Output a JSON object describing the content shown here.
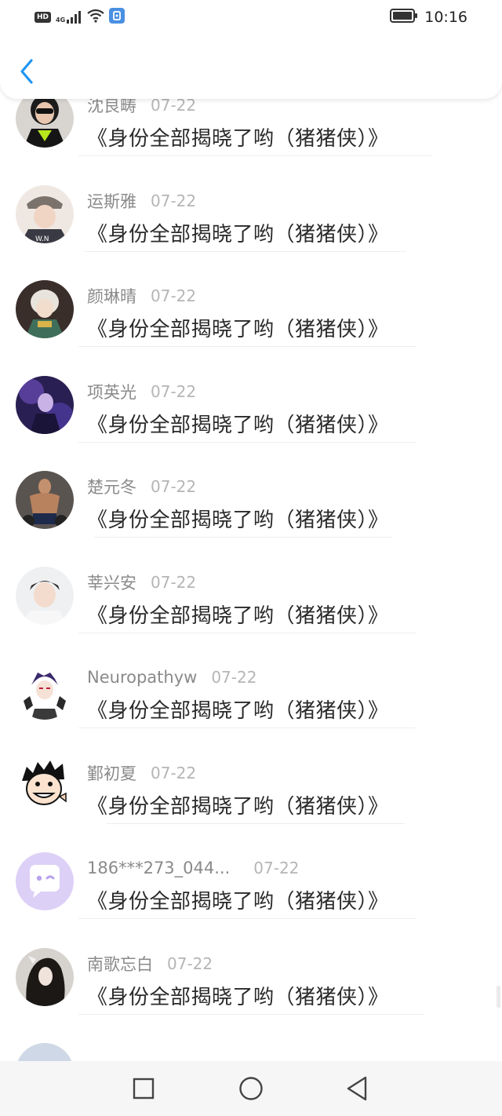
{
  "status_bar": {
    "hd_label": "HD",
    "network_label": "4G",
    "time": "10:16",
    "icons": [
      "hd-icon",
      "signal-icon",
      "wifi-icon",
      "vpn-icon",
      "battery-icon"
    ]
  },
  "header": {
    "back_icon": "chevron-left-icon",
    "accent_color": "#2196f3"
  },
  "list": {
    "items": [
      {
        "username": "沈良畴",
        "date": "07-22",
        "message": "《身份全部揭晓了哟（猪猪侠）》",
        "avatar": "avatar-woman-sunglasses"
      },
      {
        "username": "运斯雅",
        "date": "07-22",
        "message": "《身份全部揭晓了哟（猪猪侠）》",
        "avatar": "avatar-girl-cap"
      },
      {
        "username": "颜琳晴",
        "date": "07-22",
        "message": "《身份全部揭晓了哟（猪猪侠）》",
        "avatar": "avatar-anime-character"
      },
      {
        "username": "项英光",
        "date": "07-22",
        "message": "《身份全部揭晓了哟（猪猪侠）》",
        "avatar": "avatar-game-character"
      },
      {
        "username": "楚元冬",
        "date": "07-22",
        "message": "《身份全部揭晓了哟（猪猪侠）》",
        "avatar": "avatar-bodybuilder"
      },
      {
        "username": "莘兴安",
        "date": "07-22",
        "message": "《身份全部揭晓了哟（猪猪侠）》",
        "avatar": "avatar-young-man"
      },
      {
        "username": "Neuropathyw",
        "date": "07-22",
        "message": "《身份全部揭晓了哟（猪猪侠）》",
        "avatar": "avatar-anime-boy"
      },
      {
        "username": "鄞初夏",
        "date": "07-22",
        "message": "《身份全部揭晓了哟（猪猪侠）》",
        "avatar": "avatar-cartoon-grin"
      },
      {
        "username": "186***273_044...",
        "date": "07-22",
        "message": "《身份全部揭晓了哟（猪猪侠）》",
        "avatar": "avatar-default-chat"
      },
      {
        "username": "南歌忘白",
        "date": "07-22",
        "message": "《身份全部揭晓了哟（猪猪侠）》",
        "avatar": "avatar-dark-hair-woman"
      }
    ]
  },
  "nav_bar": {
    "icons": [
      "recent-apps-icon",
      "home-icon",
      "back-triangle-icon"
    ]
  }
}
